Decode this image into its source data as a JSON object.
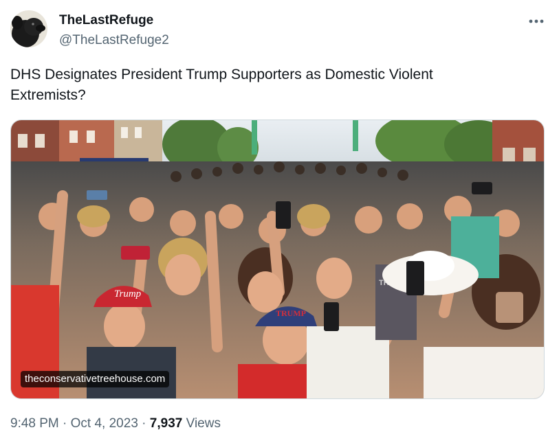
{
  "author": {
    "display_name": "TheLastRefuge",
    "handle": "@TheLastRefuge2",
    "avatar_icon": "black-dog-avatar"
  },
  "more_icon": "more-options-icon",
  "tweet": {
    "text": "DHS Designates President Trump Supporters as Domestic Violent\nExtremists?"
  },
  "media": {
    "card_domain": "theconservativetreehouse.com",
    "hat_text": "Trump",
    "shirt_text": "TRUMP",
    "hat_text_2": "TRUMP"
  },
  "meta": {
    "time": "9:48 PM",
    "separator": "·",
    "date": "Oct 4, 2023",
    "views_count": "7,937",
    "views_label": "Views"
  },
  "colors": {
    "secondary_text": "#536471",
    "primary_text": "#0f1419",
    "border": "#cfd9de"
  }
}
